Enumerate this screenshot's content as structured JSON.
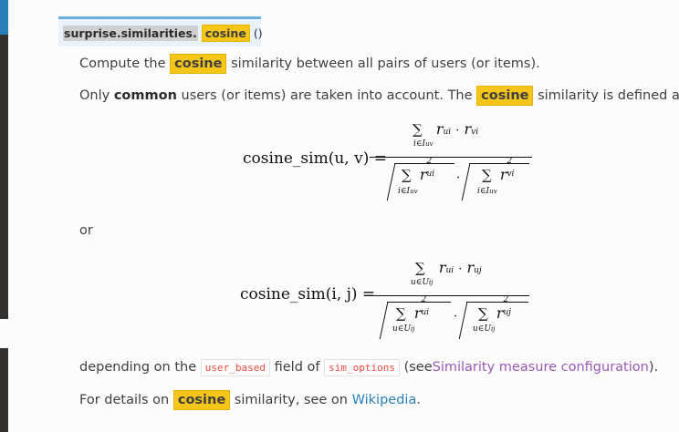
{
  "signature": {
    "module_prefix": "surprise.similarities.",
    "function_name": "cosine",
    "parens": "()"
  },
  "intro": {
    "before": "Compute the",
    "highlight": "cosine",
    "after": "similarity between all pairs of users (or items)."
  },
  "definition": {
    "only": "Only",
    "common": "common",
    "middle": "users (or items) are taken into account. The",
    "highlight": "cosine",
    "after": "similarity is defined as:"
  },
  "formula1": {
    "lhs": "cosine_sim(u, v) =",
    "sum_sub": "i∈I",
    "sum_sub_idx": "uv",
    "num_terms": "r",
    "num_sub_a": "ui",
    "num_dot": "·",
    "num_sub_b": "vi",
    "den_sub_a": "ui",
    "den_sub_b": "vi",
    "square": "2"
  },
  "or_text": "or",
  "formula2": {
    "lhs": "cosine_sim(i, j) =",
    "sum_sub": "u∈U",
    "sum_sub_idx": "ij",
    "num_terms": "r",
    "num_sub_a": "ui",
    "num_dot": "·",
    "num_sub_b": "uj",
    "den_sub_a": "ui",
    "den_sub_b": "uj",
    "square": "2"
  },
  "depending": {
    "before": "depending on the",
    "code1": "user_based",
    "middle": "field of",
    "code2": "sim_options",
    "open": "(see",
    "link": "Similarity measure configuration",
    "close": ")."
  },
  "details": {
    "before": "For details on",
    "highlight": "cosine",
    "middle": "similarity, see on",
    "link": "Wikipedia",
    "end": "."
  },
  "sum_symbol": "∑"
}
